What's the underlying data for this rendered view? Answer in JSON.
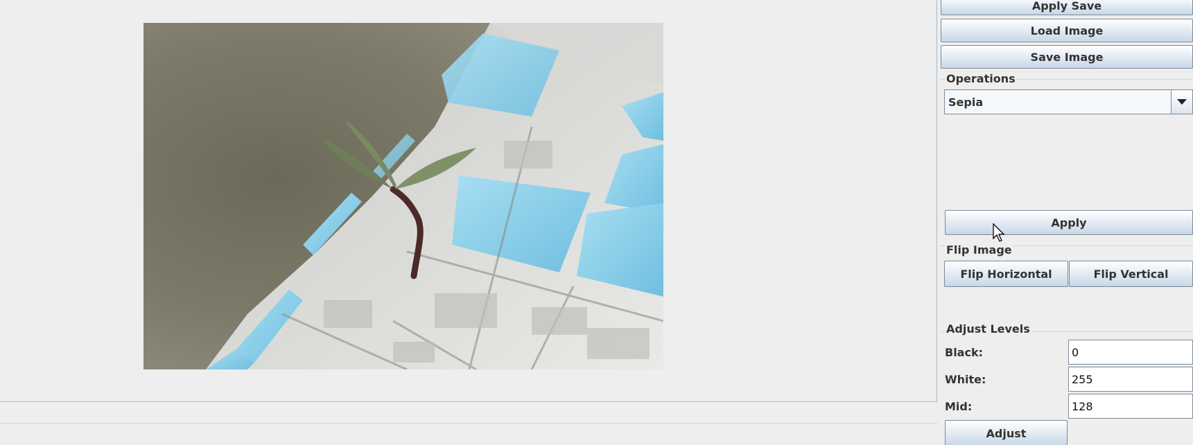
{
  "toolbar": {
    "apply_save_label": "Apply Save",
    "load_image_label": "Load Image",
    "save_image_label": "Save Image"
  },
  "operations": {
    "title": "Operations",
    "selected": "Sepia",
    "apply_label": "Apply"
  },
  "flip": {
    "title": "Flip Image",
    "horizontal_label": "Flip Horizontal",
    "vertical_label": "Flip Vertical"
  },
  "levels": {
    "title": "Adjust Levels",
    "black_label": "Black:",
    "black_value": "0",
    "white_label": "White:",
    "white_value": "255",
    "mid_label": "Mid:",
    "mid_value": "128",
    "adjust_label": "Adjust"
  },
  "colors": {
    "background": "#eeeeee",
    "tile_blue": "#8fd0ea",
    "grout": "#d9dad6"
  },
  "icons": {
    "combo_arrow": "chevron-down-icon",
    "pointer": "mouse-pointer-icon"
  }
}
